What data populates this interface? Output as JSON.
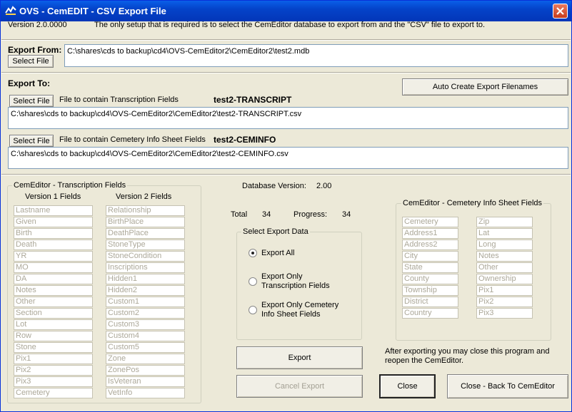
{
  "window": {
    "title": "OVS - CemEDIT - CSV Export File"
  },
  "header": {
    "version": "Version 2.0.0000",
    "setup_note": "The only setup that is required is to select the CemEditor database to export from and the \"CSV\" file to export to."
  },
  "export_from": {
    "label": "Export From:",
    "select_label": "Select File",
    "path": "C:\\shares\\cds to backup\\cd4\\OVS-CemEditor2\\CemEditor2\\test2.mdb"
  },
  "export_to": {
    "label": "Export To:",
    "auto_create_label": "Auto Create Export Filenames",
    "transcription": {
      "select_label": "Select File",
      "desc": "File to contain Transcription Fields",
      "name": "test2-TRANSCRIPT",
      "path": "C:\\shares\\cds to backup\\cd4\\OVS-CemEditor2\\CemEditor2\\test2-TRANSCRIPT.csv"
    },
    "ceminfo": {
      "select_label": "Select File",
      "desc": "File to contain Cemetery Info Sheet Fields",
      "name": "test2-CEMINFO",
      "path": "C:\\shares\\cds to backup\\cd4\\OVS-CemEditor2\\CemEditor2\\test2-CEMINFO.csv"
    }
  },
  "transcription_fields": {
    "title": "CemEditor - Transcription Fields",
    "v1_header": "Version 1 Fields",
    "v2_header": "Version 2 Fields",
    "v1": [
      "Lastname",
      "Given",
      "Birth",
      "Death",
      "YR",
      "MO",
      "DA",
      "Notes",
      "Other",
      "Section",
      "Lot",
      "Row",
      "Stone",
      "Pix1",
      "Pix2",
      "Pix3",
      "Cemetery"
    ],
    "v2": [
      "Relationship",
      "BirthPlace",
      "DeathPlace",
      "StoneType",
      "StoneCondition",
      "Inscriptions",
      "Hidden1",
      "Hidden2",
      "Custom1",
      "Custom2",
      "Custom3",
      "Custom4",
      "Custom5",
      "Zone",
      "ZonePos",
      "IsVeteran",
      "VetInfo"
    ]
  },
  "status": {
    "db_version_label": "Database Version:",
    "db_version": "2.00",
    "total_label": "Total",
    "total": "34",
    "progress_label": "Progress:",
    "progress": "34"
  },
  "select_export": {
    "title": "Select Export Data",
    "opt_all": "Export All",
    "opt_trans_1": "Export Only",
    "opt_trans_2": "Transcription Fields",
    "opt_cem_1": "Export  Only Cemetery",
    "opt_cem_2": "Info Sheet Fields"
  },
  "cem_info_fields": {
    "title": "CemEditor - Cemetery Info Sheet Fields",
    "col1": [
      "Cemetery",
      "Address1",
      "Address2",
      "City",
      "State",
      "County",
      "Township",
      "District",
      "Country"
    ],
    "col2": [
      "Zip",
      "Lat",
      "Long",
      "Notes",
      "Other",
      "Ownership",
      "Pix1",
      "Pix2",
      "Pix3"
    ]
  },
  "actions": {
    "export_label": "Export",
    "cancel_label": "Cancel Export",
    "note": "After exporting you may close this program and reopen the CemEditor.",
    "close_label": "Close",
    "close_back_label": "Close - Back To CemEditor"
  }
}
